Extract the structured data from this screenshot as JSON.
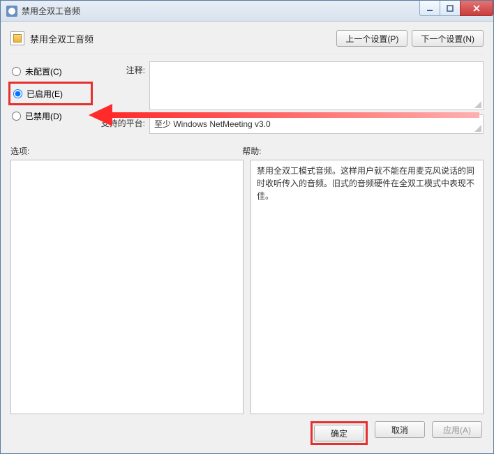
{
  "titlebar": {
    "title": "禁用全双工音频"
  },
  "header": {
    "policy_title": "禁用全双工音频",
    "prev_label": "上一个设置(P)",
    "next_label": "下一个设置(N)"
  },
  "radios": {
    "not_configured": "未配置(C)",
    "enabled": "已启用(E)",
    "disabled": "已禁用(D)"
  },
  "fields": {
    "comment_label": "注释:",
    "platform_label": "支持的平台:",
    "platform_value": "至少 Windows NetMeeting v3.0"
  },
  "sections": {
    "options_label": "选项:",
    "help_label": "帮助:"
  },
  "help_text": "禁用全双工模式音频。这样用户就不能在用麦克风说话的同时收听传入的音频。旧式的音频硬件在全双工模式中表现不佳。",
  "buttons": {
    "ok": "确定",
    "cancel": "取消",
    "apply": "应用(A)"
  }
}
